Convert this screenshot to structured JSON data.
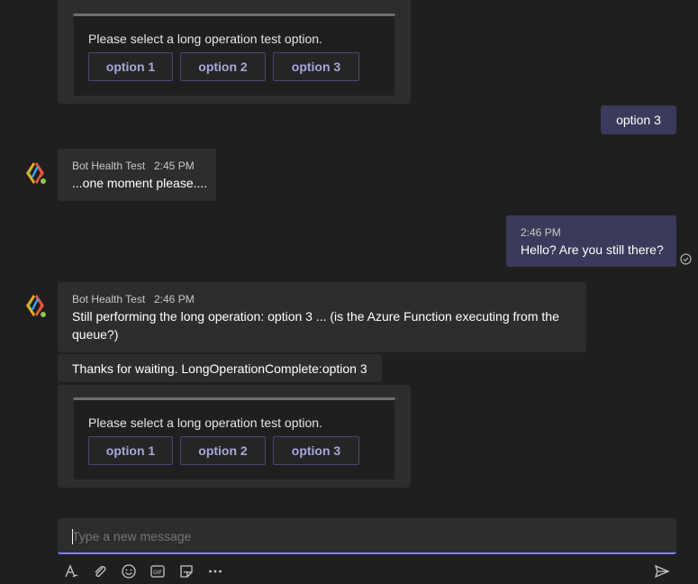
{
  "conversation": {
    "top_card": {
      "prompt": "Please select a long operation test option.",
      "options": [
        "option 1",
        "option 2",
        "option 3"
      ]
    },
    "user_reply_1": {
      "text": "option 3"
    },
    "bot_msg_1": {
      "sender": "Bot Health Test",
      "time": "2:45 PM",
      "text": "...one moment please...."
    },
    "user_msg_2": {
      "time": "2:46 PM",
      "text": "Hello? Are you still there?"
    },
    "bot_msg_2": {
      "sender": "Bot Health Test",
      "time": "2:46 PM",
      "line1": "Still performing the long operation: option 3 ... (is the Azure Function executing from the",
      "line2": "queue?)",
      "followup": "Thanks for waiting. LongOperationComplete:option 3",
      "card": {
        "prompt": "Please select a long operation test option.",
        "options": [
          "option 1",
          "option 2",
          "option 3"
        ]
      }
    }
  },
  "composer": {
    "placeholder": "Type a new message",
    "toolbar_icons": [
      "format-icon",
      "attach-icon",
      "emoji-icon",
      "gif-icon",
      "sticker-icon",
      "more-icon"
    ],
    "send_icon": "send-icon"
  },
  "colors": {
    "background": "#1f1f1f",
    "bot_bubble": "#2d2d2d",
    "user_bubble": "#3b3a5a",
    "accent": "#7f85f5",
    "presence_available": "#92c353"
  }
}
